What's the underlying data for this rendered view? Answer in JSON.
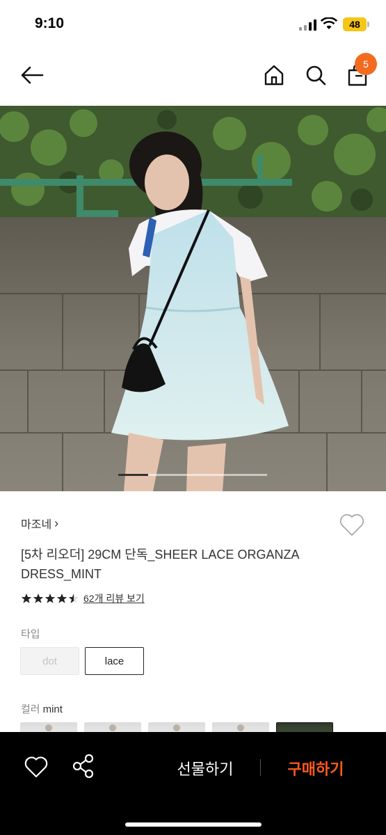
{
  "status": {
    "time": "9:10",
    "battery": "48"
  },
  "header": {
    "cart_count": "5"
  },
  "gallery": {
    "progress": 0.2
  },
  "product": {
    "brand": "마조네",
    "brand_chevron": "›",
    "title": "[5차 리오더] 29CM 단독_SHEER LACE ORGANZA DRESS_MINT",
    "rating": 4.5,
    "review_link": "62개 리뷰 보기"
  },
  "options": {
    "type_label": "타입",
    "types": [
      {
        "label": "dot",
        "state": "disabled"
      },
      {
        "label": "lace",
        "state": "selected"
      }
    ],
    "color_label": "컬러",
    "color_value": "mint",
    "color_thumb_count": 5
  },
  "bottom": {
    "gift_label": "선물하기",
    "buy_label": "구매하기"
  },
  "colors": {
    "accent": "#ff5a1f",
    "badge": "#f26b21",
    "bottom_bar": "#000000"
  },
  "icons": [
    "back-arrow-icon",
    "home-icon",
    "search-icon",
    "shopping-bag-icon",
    "heart-icon",
    "share-icon",
    "star-icon"
  ]
}
